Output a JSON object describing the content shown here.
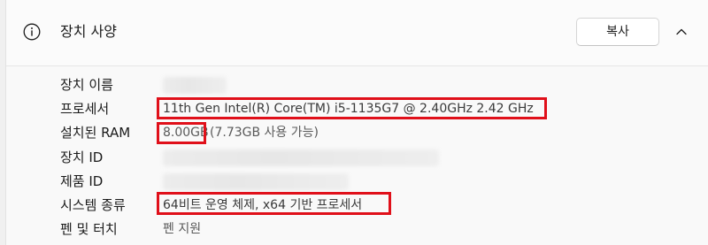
{
  "header": {
    "title": "장치 사양",
    "copy_label": "복사",
    "icons": {
      "info": "info-icon",
      "collapse": "chevron-up-icon"
    }
  },
  "specs": [
    {
      "label": "장치 이름",
      "value": ""
    },
    {
      "label": "프로세서",
      "value": "11th Gen Intel(R) Core(TM) i5-1135G7 @ 2.40GHz   2.42 GHz"
    },
    {
      "label": "설치된 RAM",
      "value_main": "8.00GB",
      "value_extra": "(7.73GB 사용 가능)"
    },
    {
      "label": "장치 ID",
      "value": ""
    },
    {
      "label": "제품 ID",
      "value": ""
    },
    {
      "label": "시스템 종류",
      "value": "64비트 운영 체제, x64 기반 프로세서"
    },
    {
      "label": "펜 및 터치",
      "value": "펜 지원"
    }
  ],
  "colors": {
    "highlight": "#e0101a",
    "accent_text": "#1b1b1b",
    "muted_text": "#5a5a5a"
  }
}
